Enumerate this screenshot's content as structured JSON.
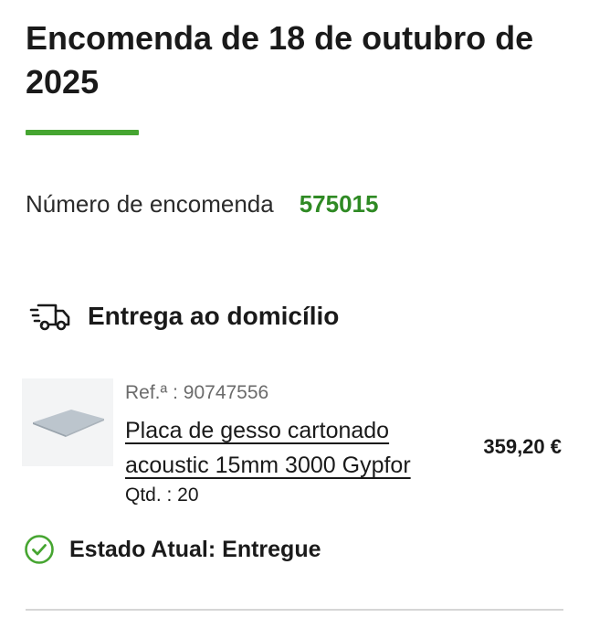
{
  "order": {
    "title": "Encomenda de 18 de outubro de 2025",
    "number_label": "Número de encomenda",
    "number_value": "575015"
  },
  "delivery": {
    "icon": "delivery-truck-icon",
    "label": "Entrega ao domicílio"
  },
  "product": {
    "ref": "Ref.ª : 90747556",
    "name": "Placa de gesso cartonado acoustic 15mm 3000 Gypfor",
    "qty": "Qtd. : 20",
    "price": "359,20 €",
    "image": "plasterboard-thumbnail"
  },
  "status": {
    "icon": "check-circle-icon",
    "text": "Estado Atual: Entregue"
  },
  "colors": {
    "accent_green": "#46a531",
    "order_number_green": "#2f8a24",
    "status_green": "#46a531",
    "divider": "#d6d6d6"
  }
}
